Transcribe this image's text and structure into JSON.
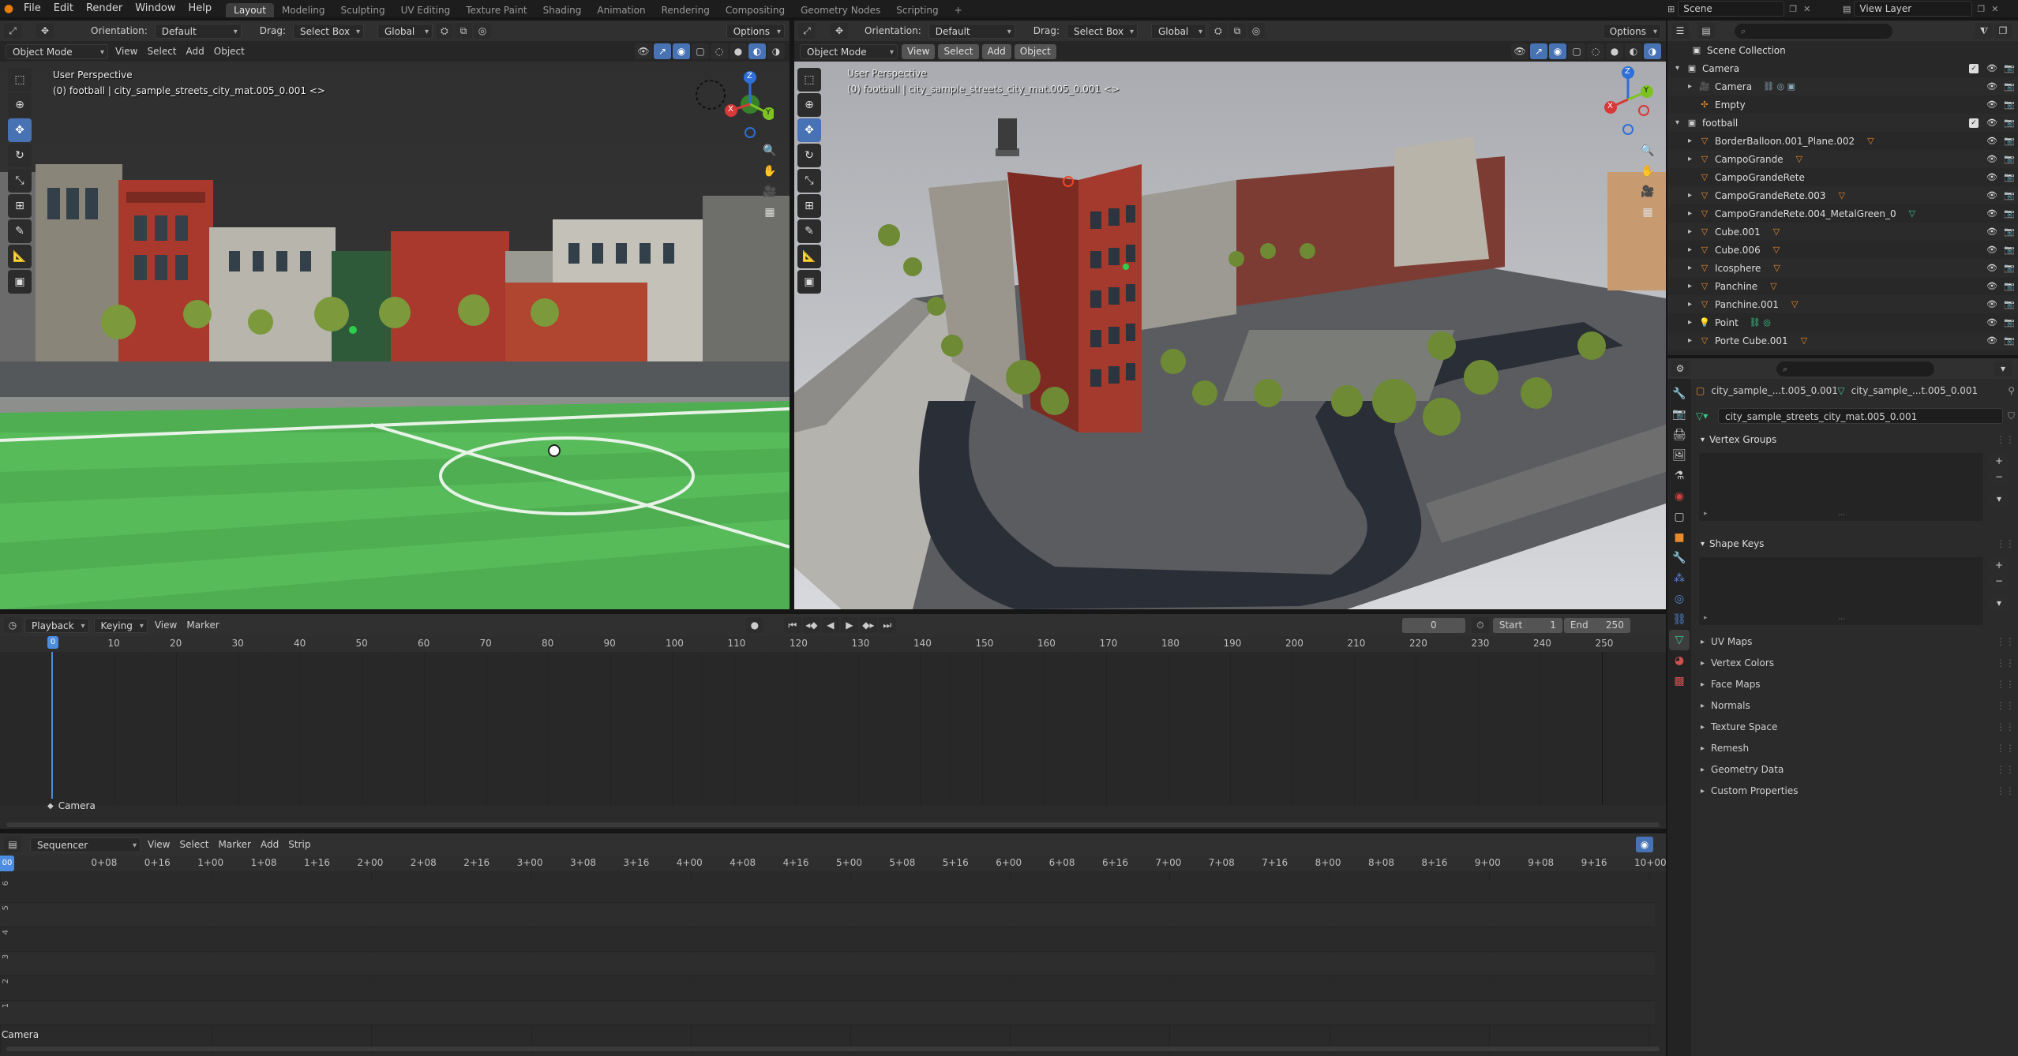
{
  "topbar": {
    "menus": [
      "File",
      "Edit",
      "Render",
      "Window",
      "Help"
    ],
    "workspaces": [
      "Layout",
      "Modeling",
      "Sculpting",
      "UV Editing",
      "Texture Paint",
      "Shading",
      "Animation",
      "Rendering",
      "Compositing",
      "Geometry Nodes",
      "Scripting"
    ],
    "active_workspace": "Layout",
    "add_tab": "+",
    "scene_label": "Scene",
    "view_layer_label": "View Layer"
  },
  "viewport_left": {
    "orientation_label": "Orientation:",
    "orientation_value": "Default",
    "drag_label": "Drag:",
    "drag_value": "Select Box",
    "transform_value": "Global",
    "options": "Options",
    "mode": "Object Mode",
    "menus": [
      "View",
      "Select",
      "Add",
      "Object"
    ],
    "perspective": "User Perspective",
    "object_info": "(0) football | city_sample_streets_city_mat.005_0.001 <>"
  },
  "viewport_right": {
    "orientation_label": "Orientation:",
    "orientation_value": "Default",
    "drag_label": "Drag:",
    "drag_value": "Select Box",
    "transform_value": "Global",
    "options": "Options",
    "mode": "Object Mode",
    "menus": [
      "View",
      "Select",
      "Add",
      "Object"
    ],
    "perspective": "User Perspective",
    "object_info": "(0) football | city_sample_streets_city_mat.005_0.001 <>"
  },
  "gizmo": {
    "x": "X",
    "y": "Y",
    "z": "Z"
  },
  "timeline": {
    "menus": [
      "Playback",
      "Keying",
      "View",
      "Marker"
    ],
    "current_frame": "0",
    "start_label": "Start",
    "start_value": "1",
    "end_label": "End",
    "end_value": "250",
    "ticks": [
      "0",
      "10",
      "20",
      "30",
      "40",
      "50",
      "60",
      "70",
      "80",
      "90",
      "100",
      "110",
      "120",
      "130",
      "140",
      "150",
      "160",
      "170",
      "180",
      "190",
      "200",
      "210",
      "220",
      "230",
      "240",
      "250"
    ],
    "marker": "Camera"
  },
  "sequencer": {
    "editor": "Sequencer",
    "menus": [
      "View",
      "Select",
      "Marker",
      "Add",
      "Strip"
    ],
    "ticks": [
      "00",
      "0+08",
      "0+16",
      "1+00",
      "1+08",
      "1+16",
      "2+00",
      "2+08",
      "2+16",
      "3+00",
      "3+08",
      "3+16",
      "4+00",
      "4+08",
      "4+16",
      "5+00",
      "5+08",
      "5+16",
      "6+00",
      "6+08",
      "6+16",
      "7+00",
      "7+08",
      "7+16",
      "8+00",
      "8+08",
      "8+16",
      "9+00",
      "9+08",
      "9+16",
      "10+00"
    ],
    "channels": [
      "6",
      "5",
      "4",
      "3",
      "2",
      "1"
    ],
    "footer": "Camera"
  },
  "outliner": {
    "root": "Scene Collection",
    "rows": [
      {
        "name": "Camera",
        "level": 1,
        "icon": "collection",
        "expand": "▾",
        "check": true
      },
      {
        "name": "Camera",
        "level": 2,
        "icon": "camera",
        "expand": "▸",
        "extra": "constraint"
      },
      {
        "name": "Empty",
        "level": 2,
        "icon": "empty",
        "expand": ""
      },
      {
        "name": "football",
        "level": 1,
        "icon": "collection",
        "expand": "▾",
        "check": true
      },
      {
        "name": "BorderBalloon.001_Plane.002",
        "level": 2,
        "icon": "mesh",
        "expand": "▸",
        "tri": "orange"
      },
      {
        "name": "CampoGrande",
        "level": 2,
        "icon": "mesh",
        "expand": "▸",
        "tri": "orange"
      },
      {
        "name": "CampoGrandeRete",
        "level": 2,
        "icon": "mesh",
        "expand": ""
      },
      {
        "name": "CampoGrandeRete.003",
        "level": 2,
        "icon": "mesh",
        "expand": "▸",
        "tri": "orange"
      },
      {
        "name": "CampoGrandeRete.004_MetalGreen_0",
        "level": 2,
        "icon": "mesh",
        "expand": "▸",
        "tri": "green"
      },
      {
        "name": "Cube.001",
        "level": 2,
        "icon": "mesh",
        "expand": "▸",
        "tri": "orange"
      },
      {
        "name": "Cube.006",
        "level": 2,
        "icon": "mesh",
        "expand": "▸",
        "tri": "orange"
      },
      {
        "name": "Icosphere",
        "level": 2,
        "icon": "mesh",
        "expand": "▸",
        "tri": "orange"
      },
      {
        "name": "Panchine",
        "level": 2,
        "icon": "mesh",
        "expand": "▸",
        "tri": "orange"
      },
      {
        "name": "Panchine.001",
        "level": 2,
        "icon": "mesh",
        "expand": "▸",
        "tri": "orange"
      },
      {
        "name": "Point",
        "level": 2,
        "icon": "light",
        "expand": "▸",
        "extra": "light"
      },
      {
        "name": "Porte Cube.001",
        "level": 2,
        "icon": "mesh",
        "expand": "▸",
        "tri": "orange"
      }
    ]
  },
  "properties": {
    "object_name": "city_sample_...t.005_0.001",
    "mesh_name": "city_sample_...t.005_0.001",
    "data_field": "city_sample_streets_city_mat.005_0.001",
    "panels": [
      {
        "title": "Vertex Groups",
        "open": true
      },
      {
        "title": "Shape Keys",
        "open": true
      }
    ],
    "subpanels": [
      "UV Maps",
      "Vertex Colors",
      "Face Maps",
      "Normals",
      "Texture Space",
      "Remesh",
      "Geometry Data",
      "Custom Properties"
    ]
  }
}
